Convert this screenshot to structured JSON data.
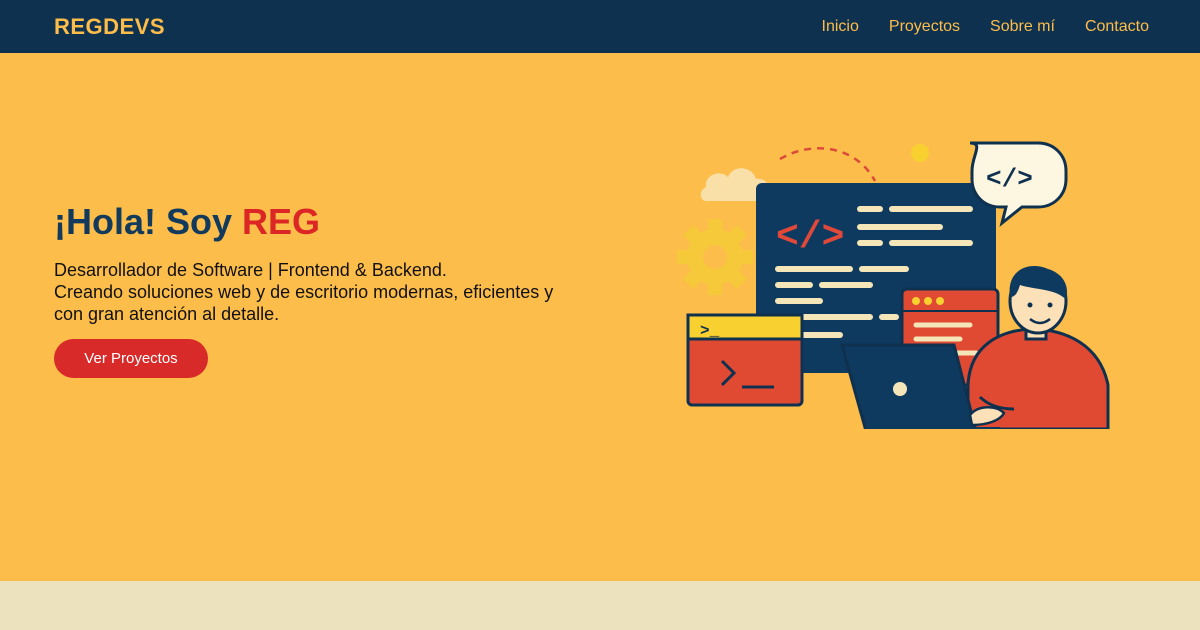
{
  "brand": "REGDEVS",
  "nav": [
    {
      "label": "Inicio"
    },
    {
      "label": "Proyectos"
    },
    {
      "label": "Sobre mí"
    },
    {
      "label": "Contacto"
    }
  ],
  "hero": {
    "greeting": "¡Hola! Soy ",
    "name": "REG",
    "lines": [
      "Desarrollador de Software | Frontend & Backend.",
      "Creando soluciones web y de escritorio modernas, eficientes y",
      "con gran atención al detalle."
    ],
    "cta_label": "Ver Proyectos"
  },
  "colors": {
    "navbar": "#0f3150",
    "hero_bg": "#fdbd4a",
    "accent_red": "#dc2626",
    "footer_band": "#ece2bd"
  },
  "icons": [
    "code-bubble-icon",
    "gear-icon",
    "cloud-icon",
    "terminal-icon",
    "laptop-icon"
  ]
}
